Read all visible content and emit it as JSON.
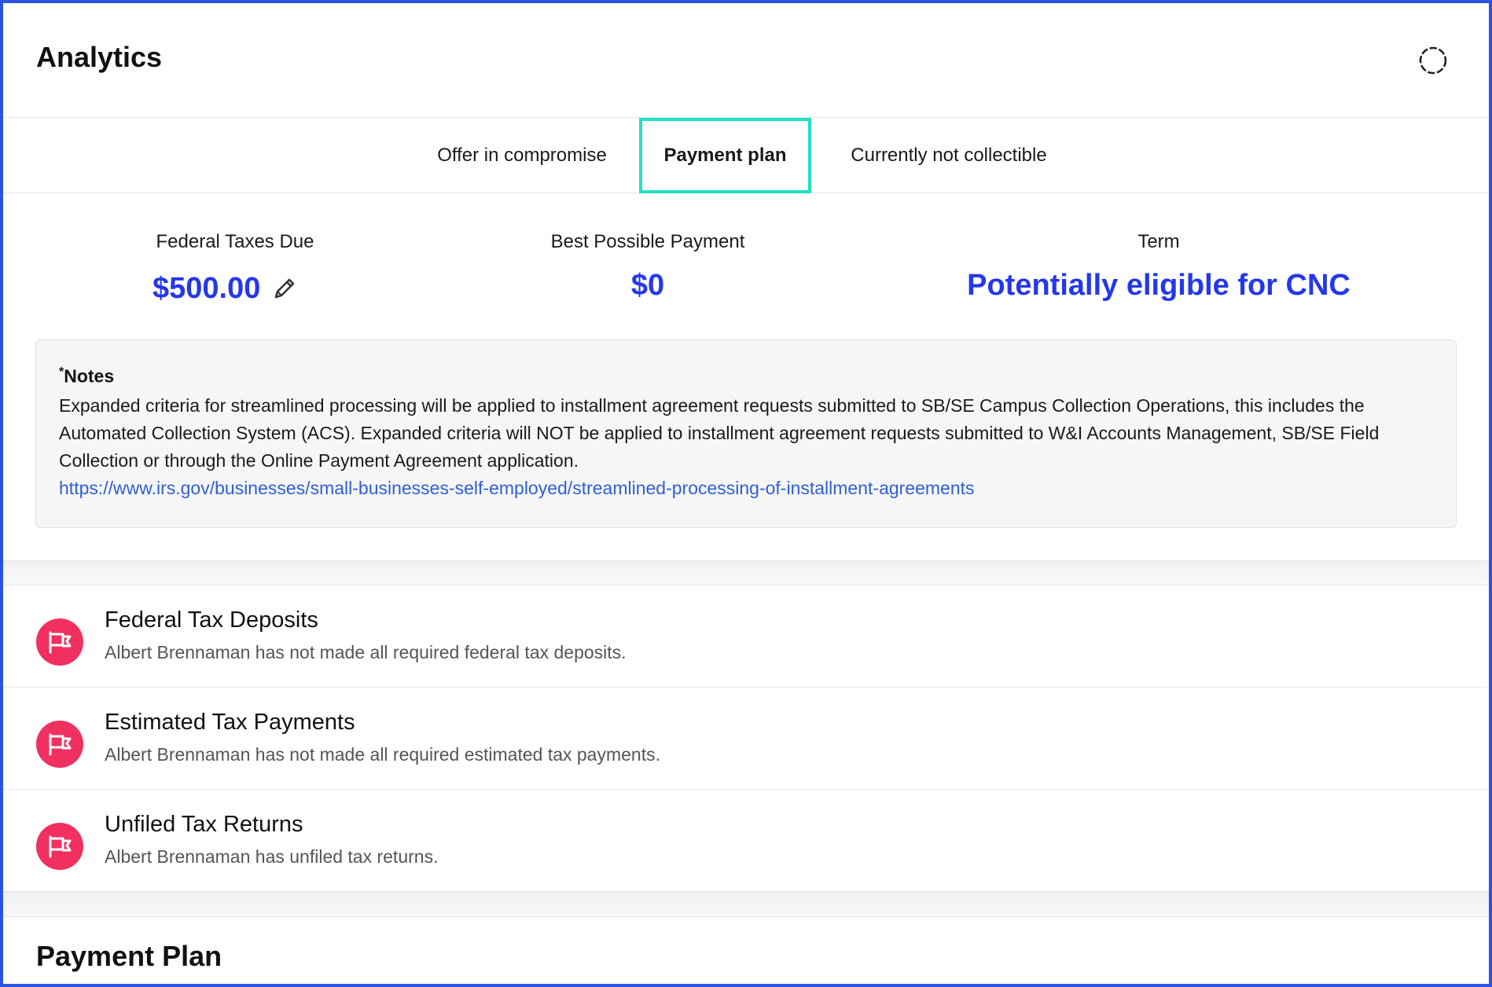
{
  "header": {
    "title": "Analytics"
  },
  "tabs": [
    {
      "label": "Offer in compromise"
    },
    {
      "label": "Payment plan"
    },
    {
      "label": "Currently not collectible"
    }
  ],
  "summary": {
    "federal_taxes_due": {
      "label": "Federal Taxes Due",
      "value": "$500.00"
    },
    "best_possible_payment": {
      "label": "Best Possible Payment",
      "value": "$0"
    },
    "term": {
      "label": "Term",
      "value": "Potentially eligible for CNC"
    }
  },
  "notes": {
    "asterisk": "*",
    "title": "Notes",
    "body": "Expanded criteria for streamlined processing will be applied to installment agreement requests submitted to SB/SE Campus Collection Operations, this includes the Automated Collection System (ACS). Expanded criteria will NOT be applied to installment agreement requests submitted to W&I Accounts Management, SB/SE Field Collection or through the Online Payment Agreement application.",
    "link": "https://www.irs.gov/businesses/small-businesses-self-employed/streamlined-processing-of-installment-agreements"
  },
  "flags": [
    {
      "title": "Federal Tax Deposits",
      "description": "Albert Brennaman has not made all required federal tax deposits.",
      "icon": "flag-icon"
    },
    {
      "title": "Estimated Tax Payments",
      "description": "Albert Brennaman has not made all required estimated tax payments.",
      "icon": "flag-icon"
    },
    {
      "title": "Unfiled Tax Returns",
      "description": "Albert Brennaman has unfiled tax returns.",
      "icon": "flag-icon"
    }
  ],
  "payment_plan": {
    "title": "Payment Plan"
  },
  "colors": {
    "accent": "#2538e8",
    "active_tab_border": "#1fe0c2",
    "flag": "#f0305f",
    "frame": "#2b52e0",
    "link": "#2f5fd6"
  }
}
